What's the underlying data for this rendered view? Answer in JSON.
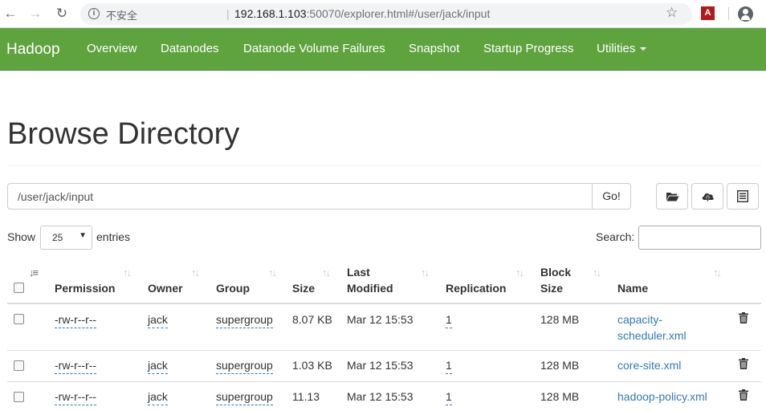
{
  "browser": {
    "insecure_label": "不安全",
    "url_host": "192.168.1.103",
    "url_rest": ":50070/explorer.html#/user/jack/input"
  },
  "navbar": {
    "brand": "Hadoop",
    "items": [
      "Overview",
      "Datanodes",
      "Datanode Volume Failures",
      "Snapshot",
      "Startup Progress",
      "Utilities"
    ]
  },
  "page": {
    "title": "Browse Directory",
    "path_value": "/user/jack/input",
    "go_label": "Go!",
    "show_label": "Show",
    "show_value": "25",
    "entries_label": "entries",
    "search_label": "Search:"
  },
  "table": {
    "headers": {
      "permission": "Permission",
      "owner": "Owner",
      "group": "Group",
      "size": "Size",
      "last_modified_1": "Last",
      "last_modified_2": "Modified",
      "replication": "Replication",
      "block_size_1": "Block",
      "block_size_2": "Size",
      "name": "Name"
    },
    "rows": [
      {
        "permission": "-rw-r--r--",
        "owner": "jack",
        "group": "supergroup",
        "size": "8.07 KB",
        "modified": "Mar 12 15:53",
        "replication": "1",
        "block_size": "128 MB",
        "name_1": "capacity-",
        "name_2": "scheduler.xml"
      },
      {
        "permission": "-rw-r--r--",
        "owner": "jack",
        "group": "supergroup",
        "size": "1.03 KB",
        "modified": "Mar 12 15:53",
        "replication": "1",
        "block_size": "128 MB",
        "name_1": "core-site.xml",
        "name_2": ""
      },
      {
        "permission": "-rw-r--r--",
        "owner": "jack",
        "group": "supergroup",
        "size": "11.13",
        "modified": "Mar 12 15:53",
        "replication": "1",
        "block_size": "128 MB",
        "name_1": "hadoop-policy.xml",
        "name_2": ""
      }
    ]
  },
  "colors": {
    "navbar": "#5fa33e",
    "link": "#337ab7"
  }
}
